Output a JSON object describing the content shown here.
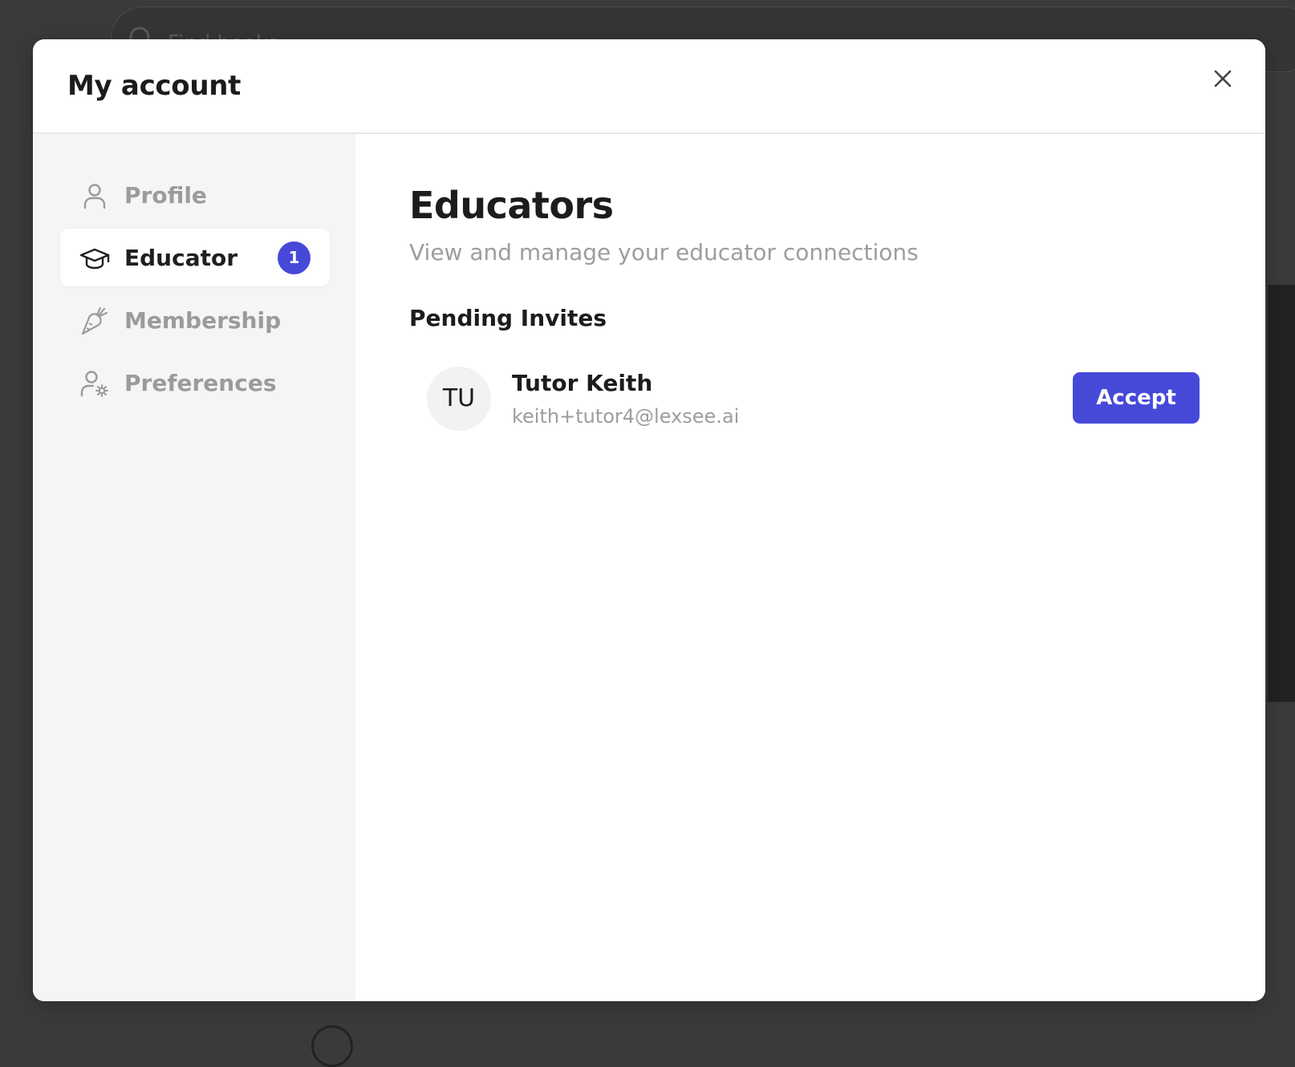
{
  "background": {
    "search_placeholder": "Find books"
  },
  "modal": {
    "title": "My account"
  },
  "sidebar": {
    "items": [
      {
        "label": "Profile",
        "icon": "user-icon",
        "active": false
      },
      {
        "label": "Educator",
        "icon": "graduation-cap-icon",
        "active": true,
        "badge": "1"
      },
      {
        "label": "Membership",
        "icon": "carrot-icon",
        "active": false
      },
      {
        "label": "Preferences",
        "icon": "user-settings-icon",
        "active": false
      }
    ]
  },
  "main": {
    "title": "Educators",
    "subtitle": "View and manage your educator connections",
    "pending_section_title": "Pending Invites",
    "invites": [
      {
        "initials": "TU",
        "name": "Tutor Keith",
        "email": "keith+tutor4@lexsee.ai",
        "action_label": "Accept"
      }
    ]
  },
  "colors": {
    "accent": "#4649d8",
    "sidebar_bg": "#f5f5f4",
    "muted_text": "#9d9d9d",
    "overlay": "#3a3a3a"
  }
}
